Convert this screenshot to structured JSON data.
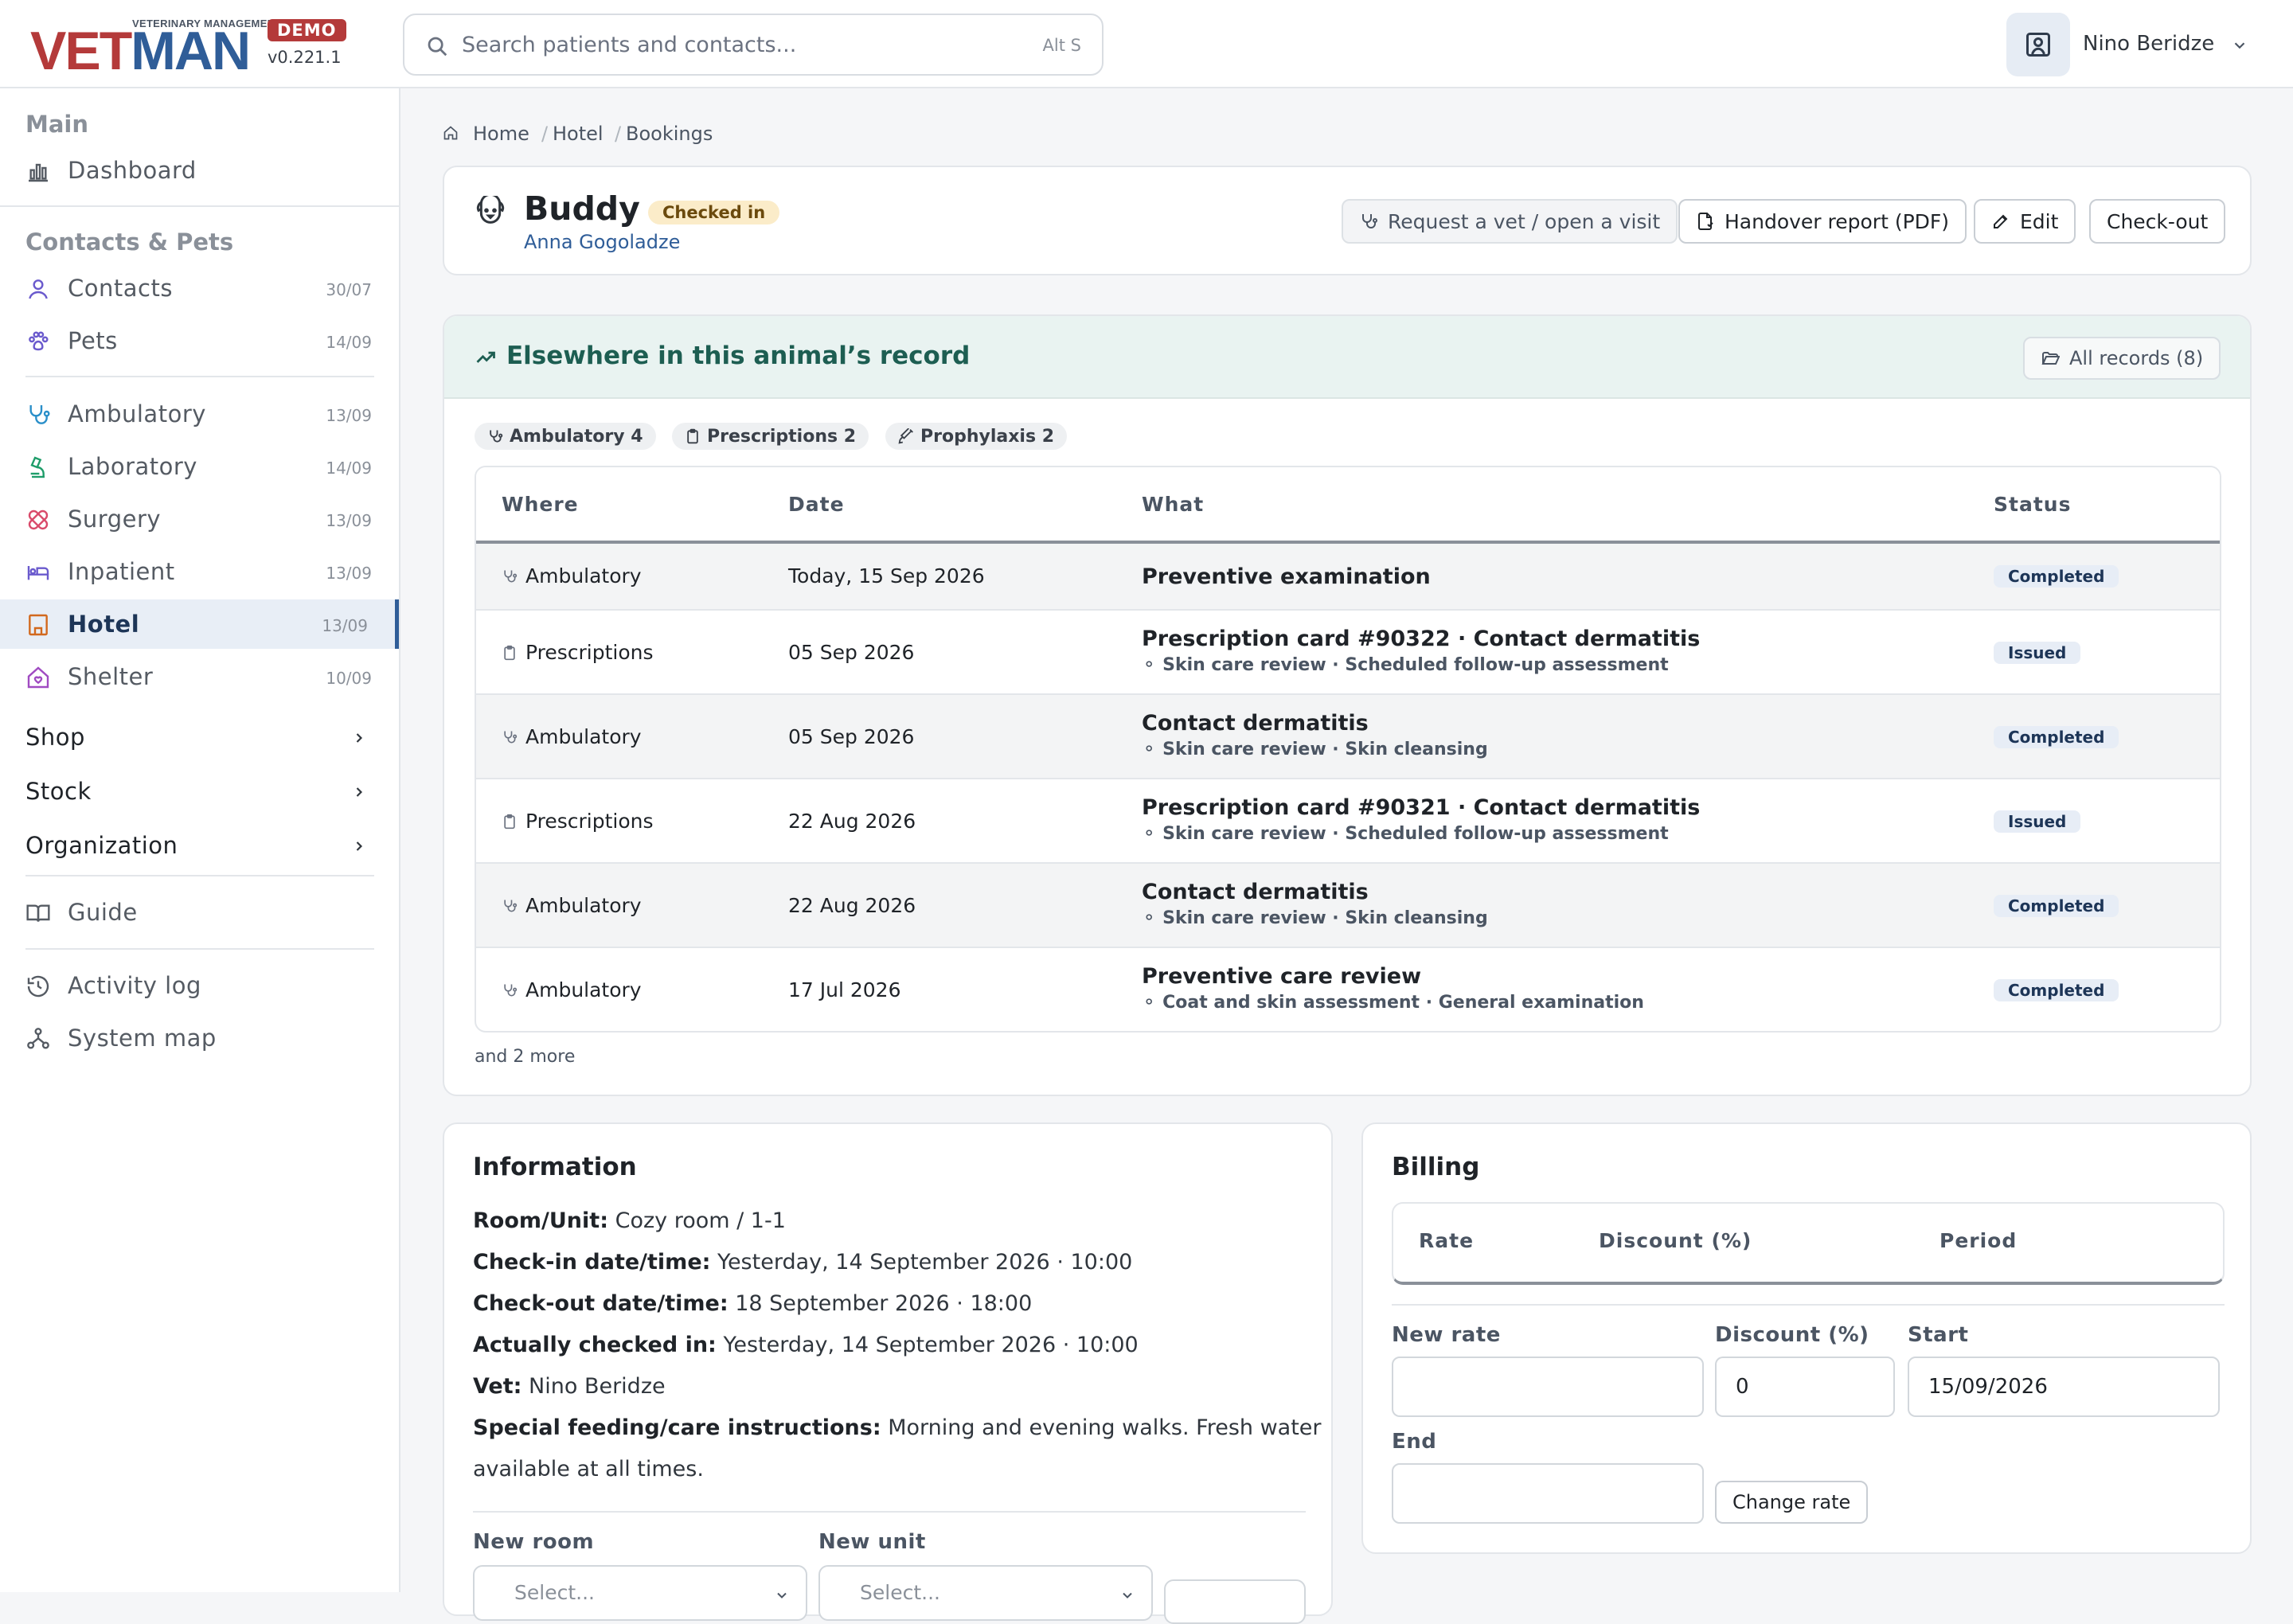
{
  "brand": {
    "wordmark_a": "VET",
    "wordmark_b": "MAN",
    "tagline": "VETERINARY MANAGEMENT",
    "badge": "DEMO",
    "version": "v0.221.1",
    "color_red": "#b43a3a",
    "color_blue": "#2f5d98"
  },
  "search": {
    "placeholder": "Search patients and contacts...",
    "shortcut": "Alt S",
    "icon": "search-icon"
  },
  "user": {
    "name": "Nino Beridze",
    "icon": "user-square-icon"
  },
  "sidebar": {
    "main_label": "Main",
    "dashboard": "Dashboard",
    "contacts_pets_label": "Contacts & Pets",
    "items": [
      {
        "label": "Contacts",
        "date": "30/07",
        "icon": "user-icon"
      },
      {
        "label": "Pets",
        "date": "14/09",
        "icon": "paw-icon"
      },
      {
        "label": "Ambulatory",
        "date": "13/09",
        "icon": "stethoscope-icon"
      },
      {
        "label": "Laboratory",
        "date": "14/09",
        "icon": "microscope-icon"
      },
      {
        "label": "Surgery",
        "date": "13/09",
        "icon": "bandage-icon"
      },
      {
        "label": "Inpatient",
        "date": "13/09",
        "icon": "bed-icon"
      },
      {
        "label": "Hotel",
        "date": "13/09",
        "icon": "building-icon",
        "active": true
      },
      {
        "label": "Shelter",
        "date": "10/09",
        "icon": "home-heart-icon"
      }
    ],
    "groups": [
      "Shop",
      "Stock",
      "Organization"
    ],
    "guide": "Guide",
    "activity_log": "Activity log",
    "system_map": "System map"
  },
  "breadcrumb": [
    "Home",
    "Hotel",
    "Bookings"
  ],
  "header": {
    "pet_name": "Buddy",
    "status": "Checked in",
    "owner": "Anna Gogoladze",
    "buttons": {
      "request_vet": "Request a vet / open a visit",
      "handover": "Handover report (PDF)",
      "edit": "Edit",
      "checkout": "Check-out"
    }
  },
  "record": {
    "title": "Elsewhere in this animal’s record",
    "all_records": "All records (8)",
    "chips": [
      {
        "label": "Ambulatory 4",
        "icon": "stethoscope-icon"
      },
      {
        "label": "Prescriptions 2",
        "icon": "clipboard-icon"
      },
      {
        "label": "Prophylaxis 2",
        "icon": "syringe-icon"
      }
    ],
    "columns": [
      "Where",
      "Date",
      "What",
      "Status"
    ],
    "rows": [
      {
        "where": "Ambulatory",
        "date": "Today, 15 Sep 2026",
        "what": "Preventive examination",
        "sub": "",
        "status": "Completed"
      },
      {
        "where": "Prescriptions",
        "date": "05 Sep 2026",
        "what": "Prescription card #90322 · Contact dermatitis",
        "sub": "Skin care review · Scheduled follow-up assessment",
        "status": "Issued"
      },
      {
        "where": "Ambulatory",
        "date": "05 Sep 2026",
        "what": "Contact dermatitis",
        "sub": "Skin care review · Skin cleansing",
        "status": "Completed"
      },
      {
        "where": "Prescriptions",
        "date": "22 Aug 2026",
        "what": "Prescription card #90321 · Contact dermatitis",
        "sub": "Skin care review · Scheduled follow-up assessment",
        "status": "Issued"
      },
      {
        "where": "Ambulatory",
        "date": "22 Aug 2026",
        "what": "Contact dermatitis",
        "sub": "Skin care review · Skin cleansing",
        "status": "Completed"
      },
      {
        "where": "Ambulatory",
        "date": "17 Jul 2026",
        "what": "Preventive care review",
        "sub": "Coat and skin assessment · General examination",
        "status": "Completed"
      }
    ],
    "more": "and 2 more"
  },
  "information": {
    "title": "Information",
    "fields": [
      {
        "label": "Room/Unit:",
        "value": "Cozy room / 1-1"
      },
      {
        "label": "Check-in date/time:",
        "value": "Yesterday, 14 September 2026 · 10:00"
      },
      {
        "label": "Check-out date/time:",
        "value": "18 September 2026 · 18:00"
      },
      {
        "label": "Actually checked in:",
        "value": "Yesterday, 14 September 2026 · 10:00"
      },
      {
        "label": "Vet:",
        "value": "Nino Beridze"
      },
      {
        "label": "Special feeding/care instructions:",
        "value": "Morning and evening walks. Fresh water",
        "value_cont": "available at all times."
      }
    ],
    "new_room_label": "New room",
    "new_unit_label": "New unit",
    "select_placeholder": "Select..."
  },
  "billing": {
    "title": "Billing",
    "columns": [
      "Rate",
      "Discount (%)",
      "Period"
    ],
    "new_rate_label": "New rate",
    "discount_label": "Discount (%)",
    "discount_value": "0",
    "start_label": "Start",
    "start_value": "15/09/2026",
    "end_label": "End",
    "change_rate": "Change rate"
  }
}
